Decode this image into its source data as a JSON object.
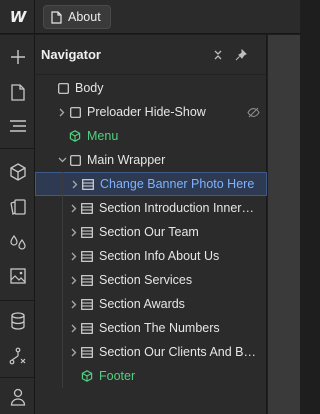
{
  "app": {
    "logo_text": "W",
    "page_tab": "About"
  },
  "navigator": {
    "title": "Navigator",
    "tree": [
      {
        "label": "Body",
        "icon": "square-icon",
        "chevron": "none",
        "color": "#e6e6e6"
      },
      {
        "label": "Preloader Hide-Show",
        "icon": "square-icon",
        "chevron": "right",
        "color": "#e6e6e6",
        "hidden_indicator": "eye-off-icon"
      },
      {
        "label": "Menu",
        "icon": "component-icon",
        "chevron": "none",
        "color": "#4fd17e"
      },
      {
        "label": "Main Wrapper",
        "icon": "square-icon",
        "chevron": "down",
        "color": "#e6e6e6"
      },
      {
        "label": "Change Banner Photo Here",
        "icon": "section-icon",
        "chevron": "right",
        "color": "#7fb2ff",
        "selected": true
      },
      {
        "label": "Section Introduction Innerpage",
        "icon": "section-icon",
        "chevron": "right",
        "color": "#e6e6e6"
      },
      {
        "label": "Section Our Team",
        "icon": "section-icon",
        "chevron": "right",
        "color": "#e6e6e6"
      },
      {
        "label": "Section Info About Us",
        "icon": "section-icon",
        "chevron": "right",
        "color": "#e6e6e6"
      },
      {
        "label": "Section Services",
        "icon": "section-icon",
        "chevron": "right",
        "color": "#e6e6e6"
      },
      {
        "label": "Section Awards",
        "icon": "section-icon",
        "chevron": "right",
        "color": "#e6e6e6"
      },
      {
        "label": "Section The Numbers",
        "icon": "section-icon",
        "chevron": "right",
        "color": "#e6e6e6"
      },
      {
        "label": "Section Our Clients And Big Te...",
        "icon": "section-icon",
        "chevron": "right",
        "color": "#e6e6e6"
      },
      {
        "label": "Footer",
        "icon": "component-icon",
        "chevron": "none",
        "color": "#4fd17e"
      }
    ]
  },
  "toolbar_icons": [
    "add-icon",
    "page-icon",
    "navigator-icon",
    "components-icon",
    "assets-icon",
    "styles-icon",
    "image-icon",
    "cms-icon",
    "logic-icon",
    "user-icon"
  ],
  "colors": {
    "accent": "#4f8dff",
    "component": "#4fd17e",
    "selected_bg": "#2d3a52"
  }
}
